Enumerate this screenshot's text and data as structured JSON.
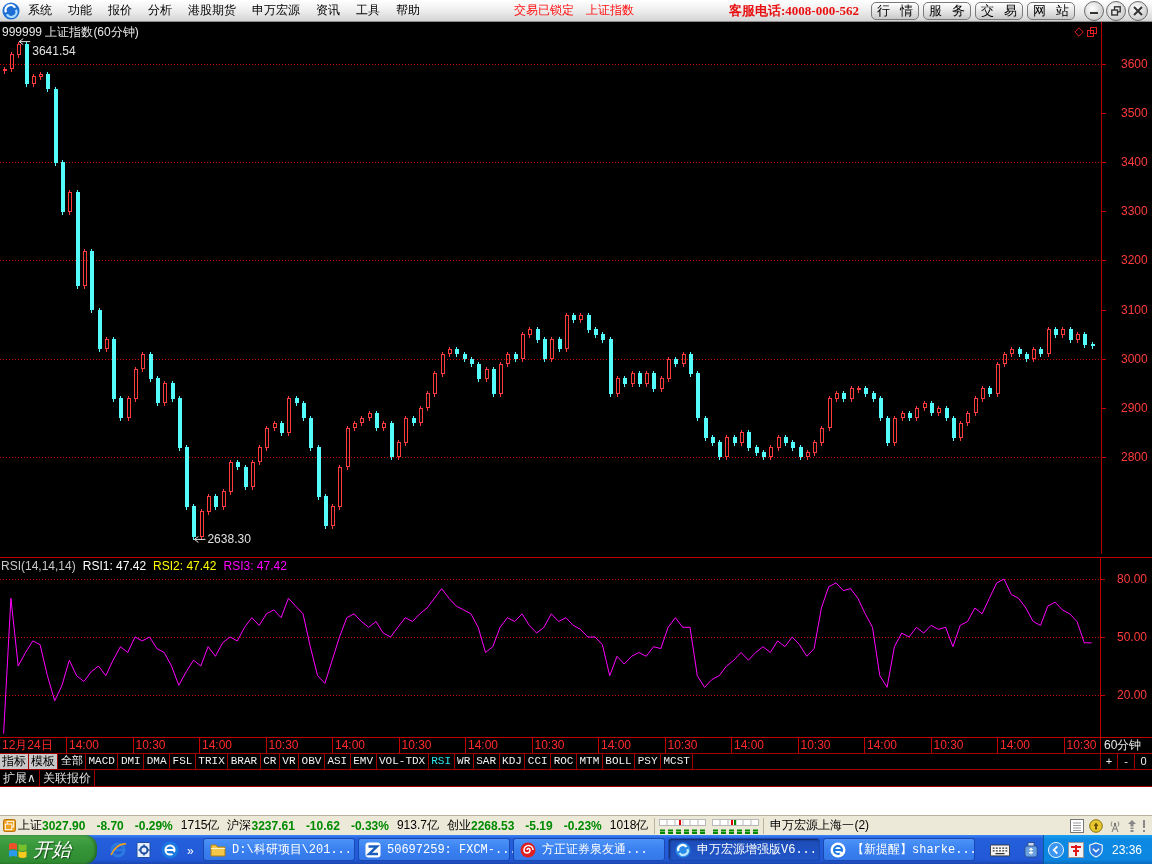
{
  "menu_bar": {
    "items": [
      "系统",
      "功能",
      "报价",
      "分析",
      "港股期货",
      "申万宏源",
      "资讯",
      "工具",
      "帮助"
    ],
    "status_texts": [
      "交易已锁定",
      "上证指数"
    ],
    "hotline": "客服电话:4008-000-562",
    "buttons": [
      "行 情",
      "服 务",
      "交 易",
      "网 站"
    ]
  },
  "price_panel": {
    "title": "999999 上证指数(60分钟)",
    "axis_labels": [
      "3600",
      "3500",
      "3400",
      "3300",
      "3200",
      "3100",
      "3000",
      "2900",
      "2800"
    ],
    "high_marker": "3641.54",
    "low_marker": "2638.30"
  },
  "rsi_panel": {
    "title": "RSI(14,14,14)",
    "legend": [
      {
        "label": "RSI1: 47.42",
        "color": "#ffffff"
      },
      {
        "label": "RSI2: 47.42",
        "color": "#ffff00"
      },
      {
        "label": "RSI3: 47.42",
        "color": "#ff00ff"
      }
    ],
    "chart_data": {
      "type": "line",
      "grid": true,
      "ylim": [
        -1.73,
        90.86
      ],
      "yticks": [
        {
          "value": 20,
          "label": "20.00"
        },
        {
          "value": 50,
          "label": "50.00"
        },
        {
          "value": 80,
          "label": "80.00"
        }
      ],
      "series": [
        {
          "color": "#ff00ff",
          "values": [
            0,
            70,
            35,
            42,
            48,
            46,
            30,
            17,
            25,
            38,
            30,
            27,
            32,
            35,
            30,
            38,
            45,
            42,
            50,
            48,
            50,
            44,
            42,
            35,
            25,
            32,
            38,
            35,
            45,
            40,
            47,
            50,
            48,
            55,
            60,
            56,
            62,
            64,
            60,
            70,
            66,
            62,
            45,
            30,
            26,
            38,
            50,
            60,
            62,
            58,
            55,
            58,
            52,
            50,
            55,
            60,
            58,
            62,
            65,
            70,
            75,
            70,
            66,
            64,
            62,
            55,
            42,
            45,
            55,
            60,
            58,
            62,
            56,
            52,
            55,
            62,
            58,
            60,
            56,
            54,
            50,
            50,
            46,
            30,
            40,
            36,
            40,
            42,
            40,
            45,
            44,
            55,
            60,
            55,
            55,
            30,
            24,
            28,
            30,
            35,
            38,
            42,
            38,
            42,
            45,
            42,
            48,
            45,
            50,
            46,
            40,
            44,
            65,
            76,
            78,
            74,
            75,
            70,
            62,
            55,
            30,
            24,
            45,
            52,
            50,
            55,
            52,
            56,
            54,
            55,
            45,
            56,
            58,
            65,
            62,
            70,
            78,
            80,
            72,
            70,
            65,
            58,
            56,
            66,
            68,
            64,
            62,
            58,
            47,
            47
          ]
        }
      ]
    }
  },
  "time_axis": {
    "labels": [
      "12月24日",
      "14:00",
      "10:30",
      "14:00",
      "10:30",
      "14:00",
      "10:30",
      "14:00",
      "10:30",
      "14:00",
      "10:30",
      "14:00",
      "10:30",
      "14:00",
      "10:30",
      "14:00",
      "10:30"
    ],
    "period": "60分钟"
  },
  "indicator_bar": {
    "panel_tabs": [
      "指标",
      "模板"
    ],
    "tabs": [
      {
        "label": "全部",
        "selected": false
      },
      {
        "label": "MACD",
        "selected": false
      },
      {
        "label": "DMI",
        "selected": false
      },
      {
        "label": "DMA",
        "selected": false
      },
      {
        "label": "FSL",
        "selected": false
      },
      {
        "label": "TRIX",
        "selected": false
      },
      {
        "label": "BRAR",
        "selected": false
      },
      {
        "label": "CR",
        "selected": false
      },
      {
        "label": "VR",
        "selected": false
      },
      {
        "label": "OBV",
        "selected": false
      },
      {
        "label": "ASI",
        "selected": false
      },
      {
        "label": "EMV",
        "selected": false
      },
      {
        "label": "VOL-TDX",
        "selected": false
      },
      {
        "label": "RSI",
        "selected": true
      },
      {
        "label": "WR",
        "selected": false
      },
      {
        "label": "SAR",
        "selected": false
      },
      {
        "label": "KDJ",
        "selected": false
      },
      {
        "label": "CCI",
        "selected": false
      },
      {
        "label": "ROC",
        "selected": false
      },
      {
        "label": "MTM",
        "selected": false
      },
      {
        "label": "BOLL",
        "selected": false
      },
      {
        "label": "PSY",
        "selected": false
      },
      {
        "label": "MCST",
        "selected": false
      }
    ],
    "zoom_buttons": [
      "+",
      "-",
      "0"
    ]
  },
  "extension_tabs": [
    "扩展∧",
    "关联报价"
  ],
  "status_bar": {
    "indices": [
      {
        "name": "上证",
        "value": "3027.90",
        "change": "-8.70",
        "percent": "-0.29%",
        "amount": "1715亿",
        "down": true
      },
      {
        "name": "沪深",
        "value": "3237.61",
        "change": "-10.62",
        "percent": "-0.33%",
        "amount": "913.7亿",
        "down": true
      },
      {
        "name": "创业",
        "value": "2268.53",
        "change": "-5.19",
        "percent": "-0.23%",
        "amount": "1018亿",
        "down": true
      }
    ],
    "server": "申万宏源上海一(2)"
  },
  "taskbar": {
    "start": "开始",
    "more": "»",
    "tasks": [
      {
        "label": "D:\\科研项目\\201...",
        "kind": "folder",
        "selected": false
      },
      {
        "label": "50697259: FXCM-...",
        "kind": "zlogo",
        "selected": false
      },
      {
        "label": "方正证券泉友通...",
        "kind": "swirl",
        "selected": false
      },
      {
        "label": "申万宏源增强版V6...",
        "kind": "ring",
        "selected": true
      },
      {
        "label": "【新提醒】sharke...",
        "kind": "browser",
        "selected": false
      }
    ],
    "clock": "23:36"
  }
}
